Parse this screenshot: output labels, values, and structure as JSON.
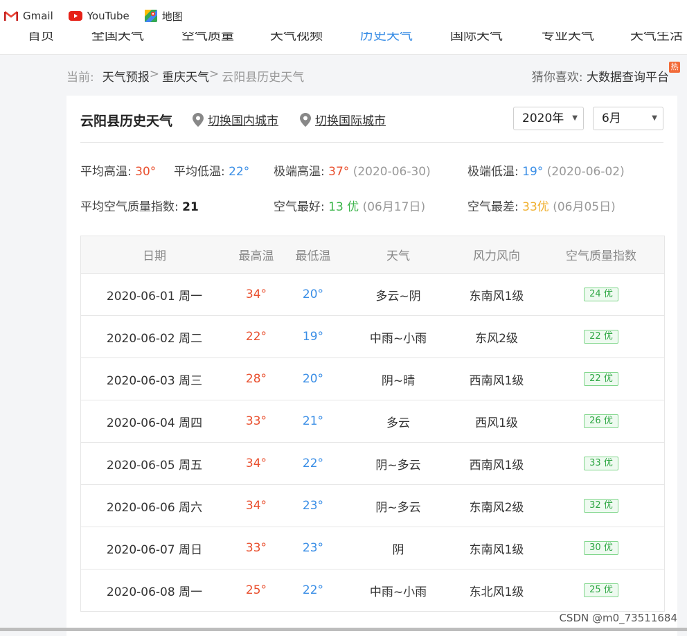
{
  "bookmarks": [
    {
      "label": "Gmail",
      "icon": "gmail-icon"
    },
    {
      "label": "YouTube",
      "icon": "youtube-icon"
    },
    {
      "label": "地图",
      "icon": "maps-icon"
    }
  ],
  "site_nav": {
    "items": [
      "首页",
      "全国天气",
      "空气质量",
      "天气视频",
      "历史天气",
      "国际天气",
      "专业天气",
      "天气生活"
    ],
    "active": "历史天气"
  },
  "breadcrumb": {
    "prefix": "当前:",
    "items": [
      "天气预报",
      "重庆天气"
    ],
    "separator": ">",
    "current": "云阳县历史天气"
  },
  "guess": {
    "label": "猜你喜欢:",
    "link": "大数据查询平台",
    "badge": "热"
  },
  "header": {
    "title": "云阳县历史天气",
    "switch_domestic": "切换国内城市",
    "switch_international": "切换国际城市",
    "year_select": "2020年",
    "month_select": "6月"
  },
  "stats": {
    "avg_high_label": "平均高温:",
    "avg_high": "30°",
    "avg_low_label": "平均低温:",
    "avg_low": "22°",
    "max_high_label": "极端高温:",
    "max_high": "37°",
    "max_high_date": "(2020-06-30)",
    "min_low_label": "极端低温:",
    "min_low": "19°",
    "min_low_date": "(2020-06-02)",
    "avg_aqi_label": "平均空气质量指数:",
    "avg_aqi": "21",
    "best_air_label": "空气最好:",
    "best_air": "13 优",
    "best_air_date": "(06月17日)",
    "worst_air_label": "空气最差:",
    "worst_air": "33优",
    "worst_air_date": "(06月05日)"
  },
  "table": {
    "columns": [
      "日期",
      "最高温",
      "最低温",
      "天气",
      "风力风向",
      "空气质量指数"
    ],
    "rows": [
      {
        "date": "2020-06-01 周一",
        "high": "34°",
        "low": "20°",
        "weather": "多云~阴",
        "wind": "东南风1级",
        "aqi": "24 优"
      },
      {
        "date": "2020-06-02 周二",
        "high": "22°",
        "low": "19°",
        "weather": "中雨~小雨",
        "wind": "东风2级",
        "aqi": "22 优"
      },
      {
        "date": "2020-06-03 周三",
        "high": "28°",
        "low": "20°",
        "weather": "阴~晴",
        "wind": "西南风1级",
        "aqi": "22 优"
      },
      {
        "date": "2020-06-04 周四",
        "high": "33°",
        "low": "21°",
        "weather": "多云",
        "wind": "西风1级",
        "aqi": "26 优"
      },
      {
        "date": "2020-06-05 周五",
        "high": "34°",
        "low": "22°",
        "weather": "阴~多云",
        "wind": "西南风1级",
        "aqi": "33 优"
      },
      {
        "date": "2020-06-06 周六",
        "high": "34°",
        "low": "23°",
        "weather": "阴~多云",
        "wind": "东南风2级",
        "aqi": "32 优"
      },
      {
        "date": "2020-06-07 周日",
        "high": "33°",
        "low": "23°",
        "weather": "阴",
        "wind": "东南风1级",
        "aqi": "30 优"
      },
      {
        "date": "2020-06-08 周一",
        "high": "25°",
        "low": "22°",
        "weather": "中雨~小雨",
        "wind": "东北风1级",
        "aqi": "25 优"
      }
    ]
  },
  "watermark": "CSDN @m0_73511684",
  "colors": {
    "high": "#e9502f",
    "low": "#3a8ee6",
    "good": "#3bb54a",
    "warn": "#f0b030",
    "active_nav": "#3a8ee6"
  }
}
